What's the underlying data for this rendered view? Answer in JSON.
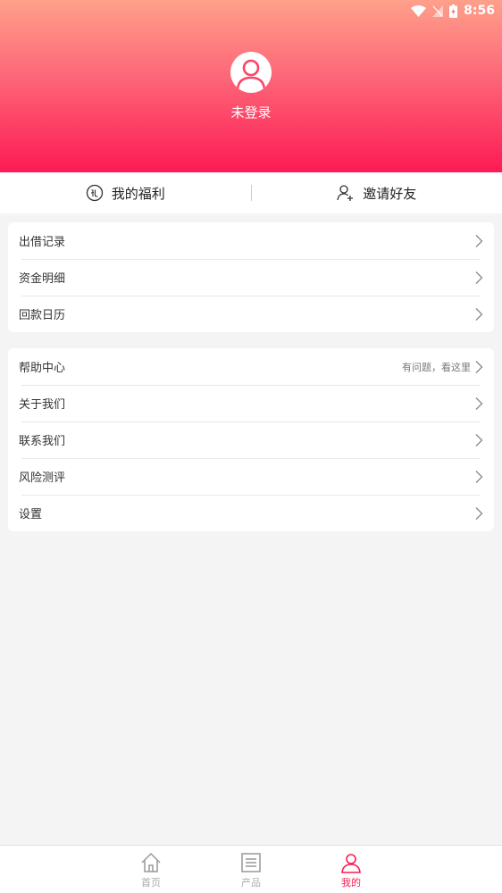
{
  "status": {
    "time": "8:56"
  },
  "profile": {
    "login_text": "未登录"
  },
  "quick": {
    "welfare": "我的福利",
    "invite": "邀请好友"
  },
  "menu1": [
    {
      "label": "出借记录"
    },
    {
      "label": "资金明细"
    },
    {
      "label": "回款日历"
    }
  ],
  "menu2": [
    {
      "label": "帮助中心",
      "hint": "有问题，看这里"
    },
    {
      "label": "关于我们"
    },
    {
      "label": "联系我们"
    },
    {
      "label": "风险测评"
    },
    {
      "label": "设置"
    }
  ],
  "tabs": [
    {
      "label": "首页"
    },
    {
      "label": "产品"
    },
    {
      "label": "我的"
    }
  ],
  "colors": {
    "accent": "#fd1a53",
    "header_top": "#fea08a"
  }
}
